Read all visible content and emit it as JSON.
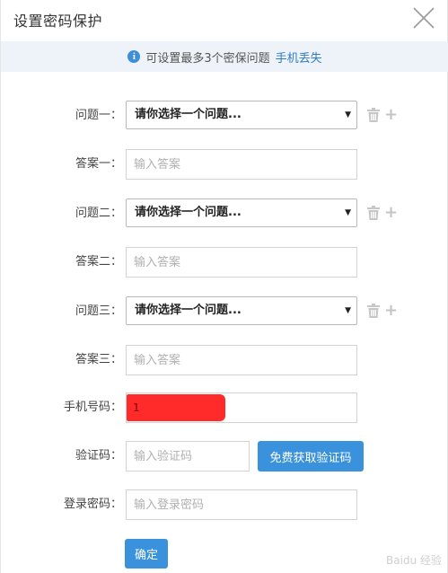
{
  "dialog": {
    "title": "设置密码保护"
  },
  "notice": {
    "text": "可设置最多3个密保问题",
    "link": "手机丢失"
  },
  "form": {
    "question_label_1": "问题一：",
    "question_label_2": "问题二：",
    "question_label_3": "问题三：",
    "answer_label_1": "答案一：",
    "answer_label_2": "答案二：",
    "answer_label_3": "答案三：",
    "select_value": "请你选择一个问题...",
    "answer_placeholder": "输入答案",
    "phone_label": "手机号码：",
    "phone_value": "1",
    "code_label": "验证码：",
    "code_placeholder": "输入验证码",
    "get_code_button": "免费获取验证码",
    "password_label": "登录密码：",
    "password_placeholder": "输入登录密码",
    "confirm_button": "确定"
  },
  "watermark": "Baidu 经验",
  "colors": {
    "accent": "#3a91dc",
    "notice_bg": "#eef3f9",
    "redaction": "#ff2a2a"
  },
  "icons": {
    "close": "close-icon",
    "info": "info-icon",
    "delete": "trash-icon",
    "add": "plus-icon"
  }
}
